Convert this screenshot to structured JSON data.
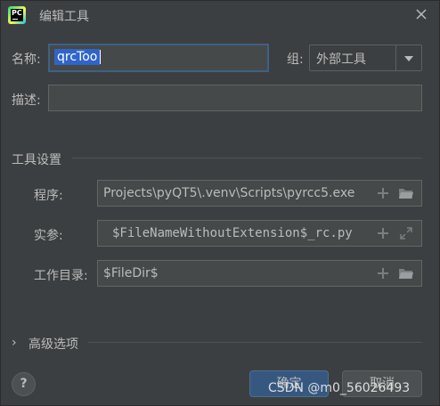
{
  "window": {
    "title": "编辑工具",
    "app_icon_text": "PC"
  },
  "form": {
    "name_label": "名称:",
    "name_value": "qrcToo",
    "group_label": "组:",
    "group_value": "外部工具",
    "desc_label": "描述:",
    "desc_value": ""
  },
  "tool_settings": {
    "title": "工具设置",
    "program_label": "程序:",
    "program_value": "Projects\\pyQT5\\.venv\\Scripts\\pyrcc5.exe",
    "args_label": "实参:",
    "args_value": "$FileNameWithoutExtension$_rc.py",
    "workdir_label": "工作目录:",
    "workdir_value": "$FileDir$"
  },
  "advanced": {
    "chevron": "›",
    "label": "高级选项"
  },
  "footer": {
    "help": "?",
    "ok_label": "确定",
    "cancel_label": "取消"
  },
  "watermark": "CSDN @m0_56026493",
  "colors": {
    "background": "#3c3f41",
    "input_bg": "#45494a",
    "focus_border": "#3d6185",
    "selection": "#2f65ca",
    "primary_button": "#365880"
  }
}
